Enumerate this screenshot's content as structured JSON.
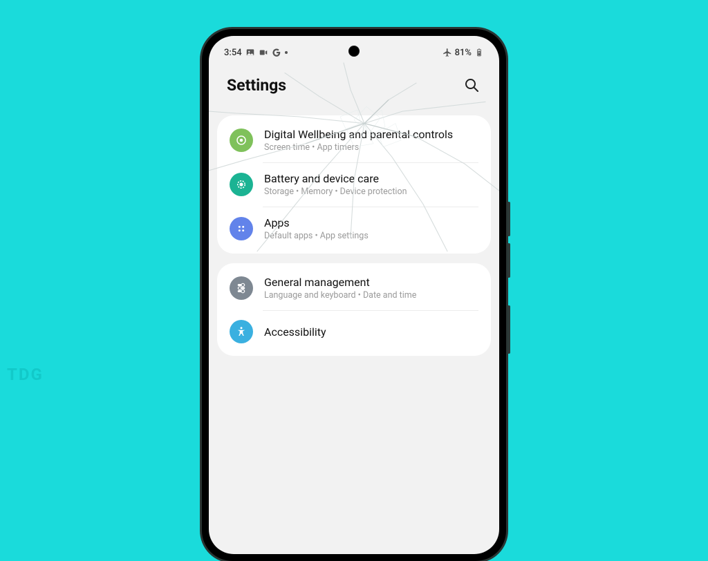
{
  "watermark": "TDG",
  "status": {
    "time": "3:54",
    "battery": "81%"
  },
  "header": {
    "title": "Settings"
  },
  "groups": [
    {
      "items": [
        {
          "title": "Digital Wellbeing and parental controls",
          "sub": "Screen time  •  App timers"
        },
        {
          "title": "Battery and device care",
          "sub": "Storage  •  Memory  •  Device protection"
        },
        {
          "title": "Apps",
          "sub": "Default apps  •  App settings"
        }
      ]
    },
    {
      "items": [
        {
          "title": "General management",
          "sub": "Language and keyboard  •  Date and time"
        },
        {
          "title": "Accessibility",
          "sub": ""
        }
      ]
    }
  ]
}
